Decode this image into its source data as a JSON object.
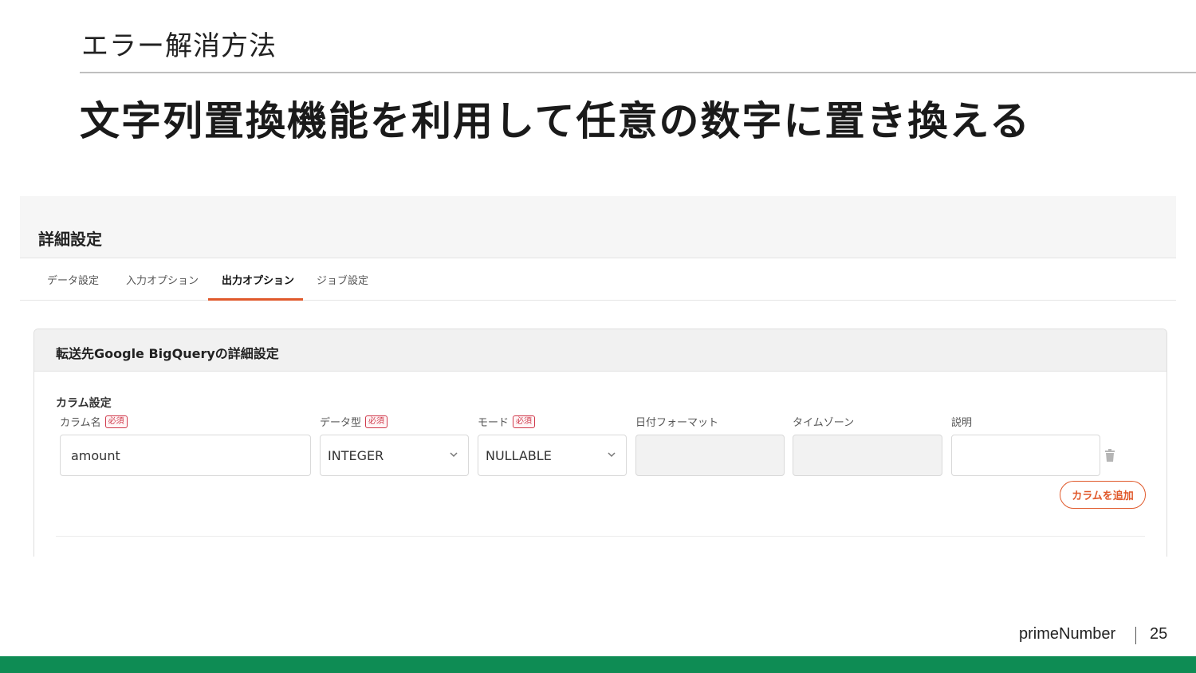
{
  "slide": {
    "section": "エラー解消方法",
    "title": "文字列置換機能を利用して任意の数字に置き換える"
  },
  "screenshot": {
    "header_title": "詳細設定",
    "tabs": [
      {
        "label": "データ設定",
        "active": false
      },
      {
        "label": "入力オプション",
        "active": false
      },
      {
        "label": "出力オプション",
        "active": true
      },
      {
        "label": "ジョブ設定",
        "active": false
      }
    ],
    "card": {
      "title": "転送先Google BigQueryの詳細設定",
      "group_label": "カラム設定",
      "required_badge": "必須",
      "columns": {
        "name": {
          "label": "カラム名",
          "value": "amount",
          "required": true
        },
        "type": {
          "label": "データ型",
          "value": "INTEGER",
          "required": true
        },
        "mode": {
          "label": "モード",
          "value": "NULLABLE",
          "required": true
        },
        "date_format": {
          "label": "日付フォーマット",
          "value": ""
        },
        "timezone": {
          "label": "タイムゾーン",
          "value": ""
        },
        "description": {
          "label": "説明",
          "value": ""
        }
      },
      "add_column_label": "カラムを追加"
    }
  },
  "footer": {
    "brand": "primeNumber",
    "page_number": "25"
  },
  "colors": {
    "accent": "#e0592b",
    "required": "#d03a4c",
    "footer_bar": "#0e8c54"
  }
}
